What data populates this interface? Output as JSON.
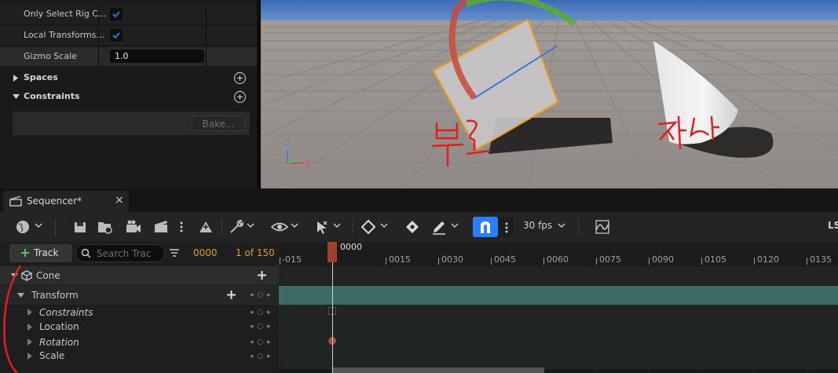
{
  "details": {
    "rows": [
      {
        "label": "Only Select Rig C...",
        "type": "checkbox",
        "checked": true
      },
      {
        "label": "Local Transforms...",
        "type": "checkbox",
        "checked": true
      },
      {
        "label": "Gizmo Scale",
        "type": "input",
        "value": "1.0"
      }
    ],
    "sections": [
      {
        "label": "Spaces",
        "expanded": false
      },
      {
        "label": "Constraints",
        "expanded": true
      }
    ],
    "bake_label": "Bake..."
  },
  "viewport": {
    "axis_z": "Z",
    "axis_x": "X",
    "annotation_left": "부모",
    "annotation_right": "자식"
  },
  "sequencer": {
    "tab_label": "Sequencer*",
    "tab_close": "×",
    "fps_label": "30 fps",
    "toolbar_right_text": "LS",
    "add_track_label": "Track",
    "search_placeholder": "Search Tracks",
    "current_frame": "0000",
    "frame_range": "1 of 150",
    "playhead_label": "0000",
    "ruler_ticks": [
      "-015",
      "0015",
      "0030",
      "0045",
      "0060",
      "0075",
      "0090",
      "0105",
      "0120",
      "0135"
    ],
    "tracks": [
      {
        "name": "Cone",
        "level": 0,
        "expanded": true,
        "italic": false
      },
      {
        "name": "Transform",
        "level": 1,
        "expanded": true,
        "italic": false
      },
      {
        "name": "Constraints",
        "level": 2,
        "expanded": false,
        "italic": true
      },
      {
        "name": "Location",
        "level": 2,
        "expanded": false,
        "italic": false
      },
      {
        "name": "Rotation",
        "level": 2,
        "expanded": false,
        "italic": true
      },
      {
        "name": "Scale",
        "level": 2,
        "expanded": false,
        "italic": false
      }
    ],
    "key_controls": "◂ ○ ▸"
  },
  "colors": {
    "accent_orange": "#e0a020",
    "checkbox_blue": "#1a7fd6",
    "magnet_blue": "#2a7fff",
    "track_teal": "#3e6b66",
    "annotation_red": "#e02020",
    "playhead": "#a04030"
  }
}
